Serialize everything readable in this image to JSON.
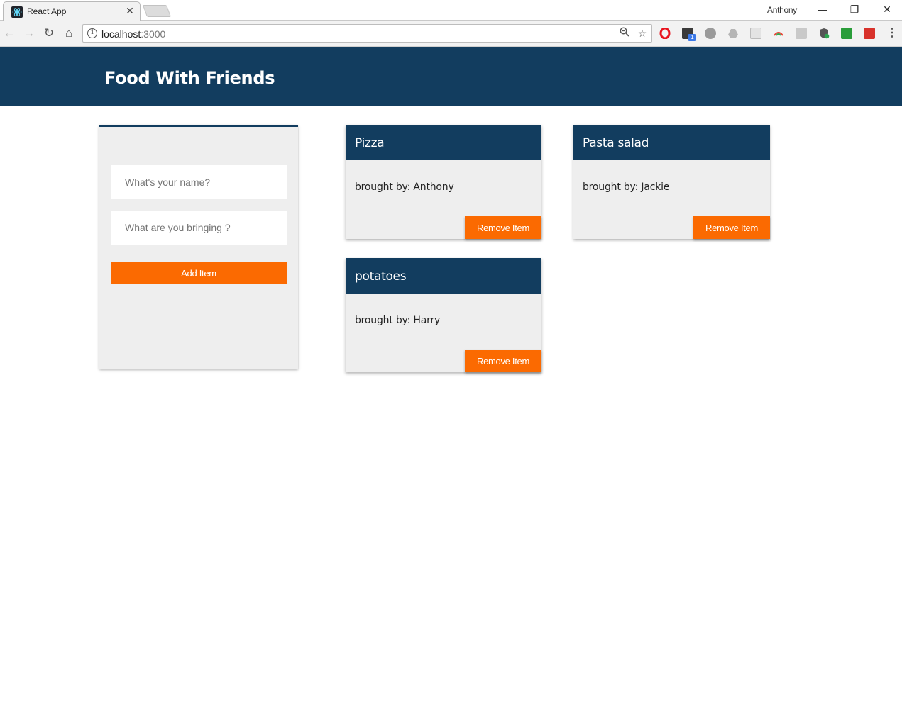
{
  "browser": {
    "tab_title": "React App",
    "profile_name": "Anthony",
    "url_host": "localhost",
    "url_port": ":3000",
    "icons": {
      "back": "arrow-left-icon",
      "forward": "arrow-right-icon",
      "reload": "reload-icon",
      "home": "home-icon",
      "zoom": "zoom-out-icon",
      "bookmark": "star-icon",
      "menu": "kebab-menu-icon"
    },
    "extension_badge": "1"
  },
  "app": {
    "title": "Food With Friends",
    "header_color": "#123d5f",
    "accent_color": "#fb6a01"
  },
  "form": {
    "name_placeholder": "What's your name?",
    "item_placeholder": "What are you bringing ?",
    "add_button": "Add Item"
  },
  "items": [
    {
      "title": "Pizza",
      "brought_by": "brought by: Anthony",
      "remove_label": "Remove Item"
    },
    {
      "title": "Pasta salad",
      "brought_by": "brought by: Jackie",
      "remove_label": "Remove Item"
    },
    {
      "title": "potatoes",
      "brought_by": "brought by: Harry",
      "remove_label": "Remove Item"
    }
  ]
}
